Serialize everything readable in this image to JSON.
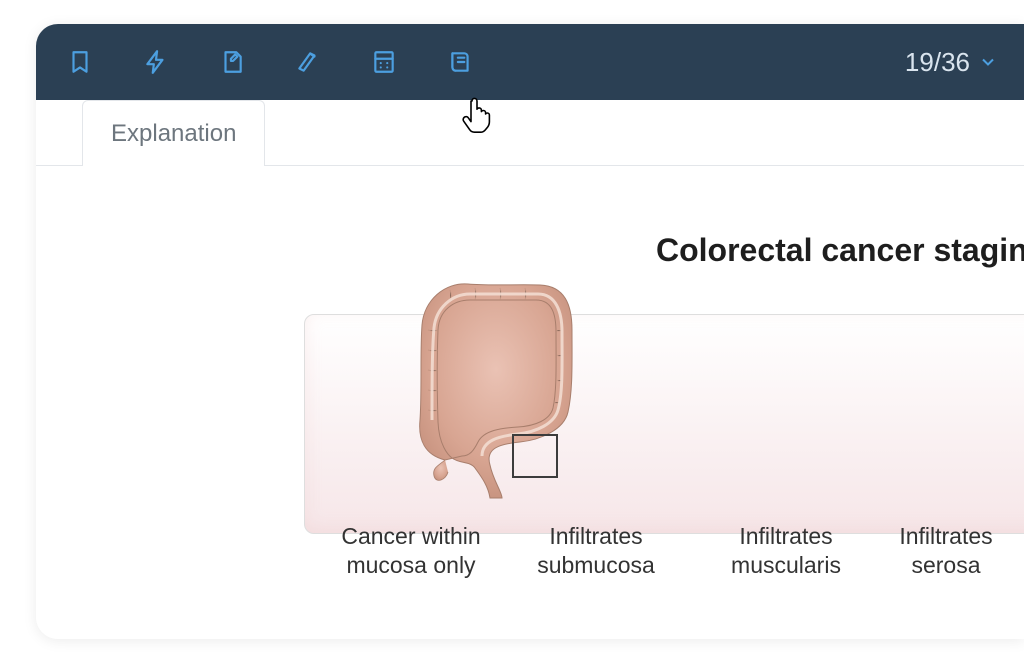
{
  "toolbar": {
    "icons": {
      "bookmark": "bookmark-icon",
      "flash": "flash-icon",
      "note": "note-icon",
      "highlighter": "highlighter-icon",
      "calculator": "calculator-icon",
      "book": "book-icon"
    },
    "page_indicator": "19/36"
  },
  "tabs": {
    "explanation": "Explanation"
  },
  "content": {
    "title": "Colorectal cancer staging",
    "labels": [
      {
        "line1": "Cancer within",
        "line2": "mucosa only"
      },
      {
        "line1": "Infiltrates",
        "line2": "submucosa"
      },
      {
        "line1": "Infiltrates",
        "line2": "muscularis"
      },
      {
        "line1": "Infiltrates",
        "line2": "serosa"
      }
    ]
  },
  "colors": {
    "toolbar_bg": "#2b4054",
    "accent": "#4c9fe0",
    "text_muted": "#6d767e"
  }
}
